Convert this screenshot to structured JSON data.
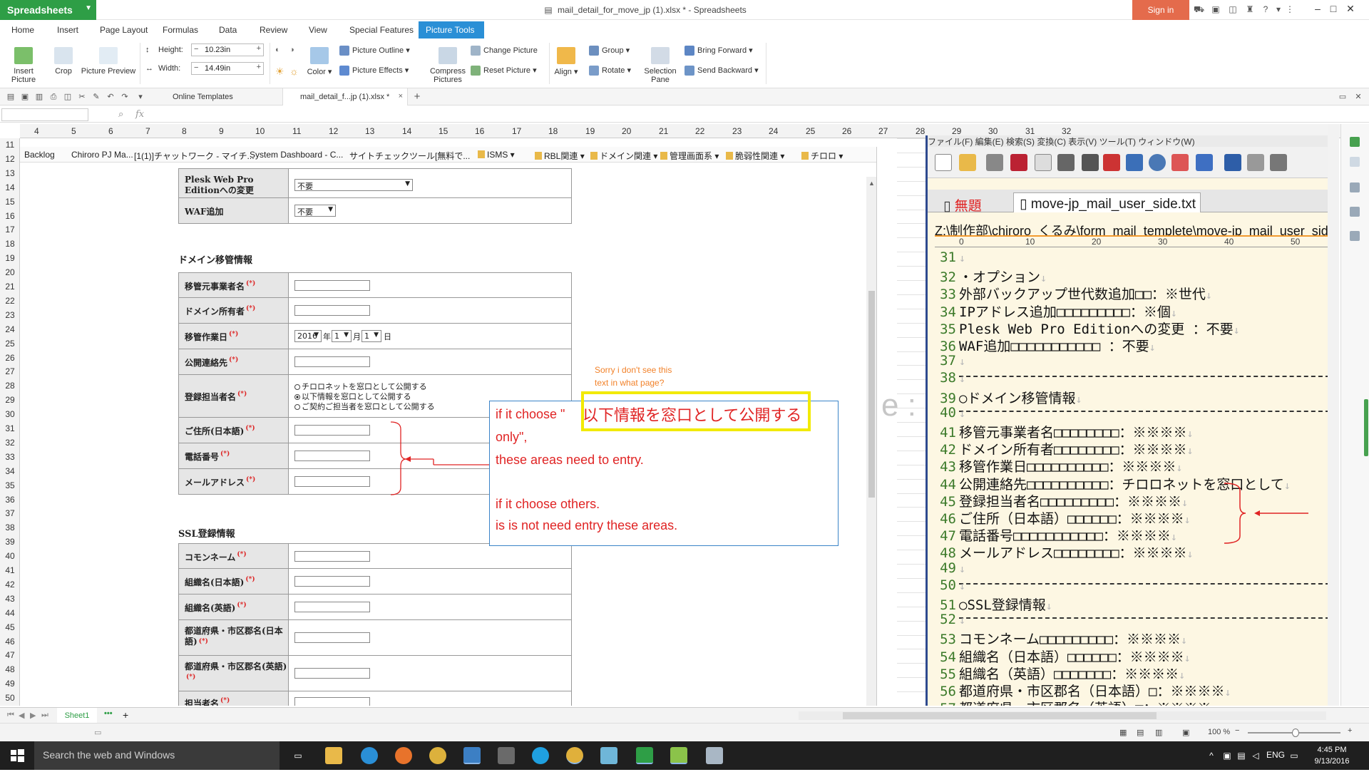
{
  "app": {
    "name": "Spreadsheets",
    "document_title": "mail_detail_for_move_jp (1).xlsx * - Spreadsheets",
    "sign_in": "Sign in",
    "accent": "#2e9e46"
  },
  "menu": [
    "Home",
    "Insert",
    "Page Layout",
    "Formulas",
    "Data",
    "Review",
    "View",
    "Special Features",
    "Picture Tools"
  ],
  "menu_active": "Picture Tools",
  "ribbon": {
    "insert_picture": "Insert Picture",
    "crop": "Crop",
    "picture_preview": "Picture Preview",
    "height_label": "Height:",
    "height_value": "10.23in",
    "width_label": "Width:",
    "width_value": "14.49in",
    "color": "Color",
    "picture_outline": "Picture Outline",
    "picture_effects": "Picture Effects",
    "change_picture": "Change Picture",
    "reset_picture": "Reset Picture",
    "compress_pictures": "Compress Pictures",
    "align": "Align",
    "group": "Group",
    "rotate": "Rotate",
    "selection_pane": "Selection Pane",
    "bring_forward": "Bring Forward",
    "send_backward": "Send Backward"
  },
  "doc_tabs": [
    "Online Templates",
    "mail_detail_f...jp (1).xlsx *"
  ],
  "formula_bar": {
    "fx": "fx",
    "value": ""
  },
  "columns": [
    "4",
    "5",
    "6",
    "7",
    "8",
    "9",
    "10",
    "11",
    "12",
    "13",
    "14",
    "15",
    "16",
    "17",
    "18",
    "19",
    "20",
    "21",
    "22",
    "23",
    "24",
    "25",
    "26",
    "27",
    "28",
    "29",
    "30",
    "31",
    "32"
  ],
  "rows": [
    "11",
    "12",
    "13",
    "14",
    "15",
    "16",
    "17",
    "18",
    "19",
    "20",
    "21",
    "22",
    "23",
    "24",
    "25",
    "26",
    "27",
    "28",
    "29",
    "30",
    "31",
    "32",
    "33",
    "34",
    "35",
    "36",
    "37",
    "38",
    "39",
    "40",
    "41",
    "42",
    "43",
    "44",
    "45",
    "46",
    "47",
    "48",
    "49",
    "50"
  ],
  "bookmarks": [
    "Backlog",
    "Chiroro PJ Ma...",
    "[1(1)]チャットワーク - マイチ...",
    "System Dashboard - C...",
    "サイトチェックツール[無料で...",
    "ISMS",
    "RBL関連",
    "ドメイン関連",
    "管理画面系",
    "脆弱性関連",
    "チロロ"
  ],
  "form": {
    "plesk_label": "Plesk Web Pro Editionへの変更",
    "plesk_value": "不要",
    "waf_label": "WAF追加",
    "waf_value": "不要",
    "domain_section": "ドメイン移管情報",
    "from_company": "移管元事業者名",
    "domain_owner": "ドメイン所有者",
    "move_date": "移管作業日",
    "date_year": "2016",
    "date_year_unit": "年",
    "date_month": "1",
    "date_month_unit": "月",
    "date_day": "1",
    "date_day_unit": "日",
    "public_contact": "公開連絡先",
    "registrant": "登録担当者名",
    "radio1": "チロロネットを窓口として公開する",
    "radio2": "以下情報を窓口として公開する",
    "radio3": "ご契約ご担当者を窓口として公開する",
    "address_jp": "ご住所(日本語)",
    "phone": "電話番号",
    "email": "メールアドレス",
    "ssl_section": "SSL登録情報",
    "common_name": "コモンネーム",
    "org_jp": "組織名(日本語)",
    "org_en": "組織名(英語)",
    "pref_jp": "都道府県・市区郡名(日本語)",
    "pref_en": "都道府県・市区郡名(英語)",
    "contact_name": "担当者名",
    "required_mark": "(*)"
  },
  "annotations": {
    "question_line1": "Sorry i don't see this",
    "question_line2": "text in what page?",
    "highlight": "以下情報を窓口として公開する",
    "note_line1": "if it choose \"",
    "note_line2": "only\",",
    "note_line3": "these areas need to entry.",
    "note_line4": "if it choose others.",
    "note_line5": "is is not need entry these areas.",
    "fragment": "e :",
    "note_color": "#e02424",
    "highlight_color": "#f2ea00"
  },
  "editor": {
    "menu": "ファイル(F)  編集(E)  検索(S)  変換(C)  表示(V)  ツール(T)  ウィンドウ(W)",
    "tab_untitled": "無題",
    "tab_file": "move-jp_mail_user_side.txt",
    "path": "Z:\\制作部\\chiroro_くるみ\\form_mail_templete\\move-jp_mail_user_side.txt",
    "ruler": [
      "0",
      "10",
      "20",
      "30",
      "40",
      "50"
    ],
    "lines": [
      {
        "n": "31",
        "t": ""
      },
      {
        "n": "32",
        "t": "・オプション"
      },
      {
        "n": "33",
        "t": "外部バックアップ世代数追加□□：※世代"
      },
      {
        "n": "34",
        "t": "IPアドレス追加□□□□□□□□□：※個"
      },
      {
        "n": "35",
        "t": "Plesk Web Pro Editionへの変更 ：不要"
      },
      {
        "n": "36",
        "t": "WAF追加□□□□□□□□□□□ ：不要"
      },
      {
        "n": "37",
        "t": ""
      },
      {
        "n": "38",
        "t": ""
      },
      {
        "n": "39",
        "t": "○ドメイン移管情報"
      },
      {
        "n": "40",
        "t": ""
      },
      {
        "n": "41",
        "t": "移管元事業者名□□□□□□□□：※※※※"
      },
      {
        "n": "42",
        "t": "ドメイン所有者□□□□□□□□：※※※※"
      },
      {
        "n": "43",
        "t": "移管作業日□□□□□□□□□□：※※※※"
      },
      {
        "n": "44",
        "t": "公開連絡先□□□□□□□□□□：チロロネットを窓口として"
      },
      {
        "n": "45",
        "t": "登録担当者名□□□□□□□□□：※※※※"
      },
      {
        "n": "46",
        "t": "ご住所（日本語）□□□□□□：※※※※"
      },
      {
        "n": "47",
        "t": "電話番号□□□□□□□□□□□：※※※※"
      },
      {
        "n": "48",
        "t": "メールアドレス□□□□□□□□：※※※※"
      },
      {
        "n": "49",
        "t": ""
      },
      {
        "n": "50",
        "t": ""
      },
      {
        "n": "51",
        "t": "○SSL登録情報"
      },
      {
        "n": "52",
        "t": ""
      },
      {
        "n": "53",
        "t": "コモンネーム□□□□□□□□□：※※※※"
      },
      {
        "n": "54",
        "t": "組織名（日本語）□□□□□□：※※※※"
      },
      {
        "n": "55",
        "t": "組織名（英語）□□□□□□□：※※※※"
      },
      {
        "n": "56",
        "t": "都道府県・市区郡名（日本語）□：※※※※"
      },
      {
        "n": "57",
        "t": "都道府県・市区郡名（英語）□：※※※※"
      }
    ]
  },
  "sheet": {
    "tab": "Sheet1",
    "zoom": "100 %"
  },
  "taskbar": {
    "search": "Search the web and Windows",
    "lang": "ENG",
    "time": "4:45 PM",
    "date": "9/13/2016"
  }
}
